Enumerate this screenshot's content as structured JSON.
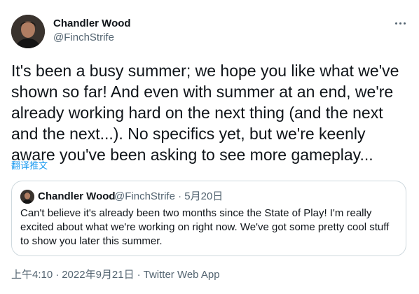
{
  "author": {
    "name": "Chandler Wood",
    "handle": "@FinchStrife"
  },
  "tweet": {
    "text": "It's been a busy summer; we hope you like what we've\nshown so far! And even with summer at an end, we're\nalready working hard on the next thing (and the next\nand the next...). No specifics yet, but we're keenly\naware you've been asking to see more gameplay...",
    "translate_label": "翻译推文"
  },
  "quoted_tweet": {
    "name": "Chandler Wood",
    "handle": "@FinchStrife",
    "separator": "·",
    "date": "5月20日",
    "text": "Can't believe it's already been two months since the State of Play! I'm really\nexcited about what we're working on right now. We've got some pretty cool stuff\nto show you later this summer."
  },
  "meta": {
    "time": "上午4:10",
    "sep1": "·",
    "date": "2022年9月21日",
    "sep2": "·",
    "source": "Twitter Web App"
  },
  "icons": {
    "more": "more-horizontal-icon"
  },
  "colors": {
    "link": "#1d9bf0",
    "secondary_text": "#536471",
    "border": "#cfd9de"
  }
}
